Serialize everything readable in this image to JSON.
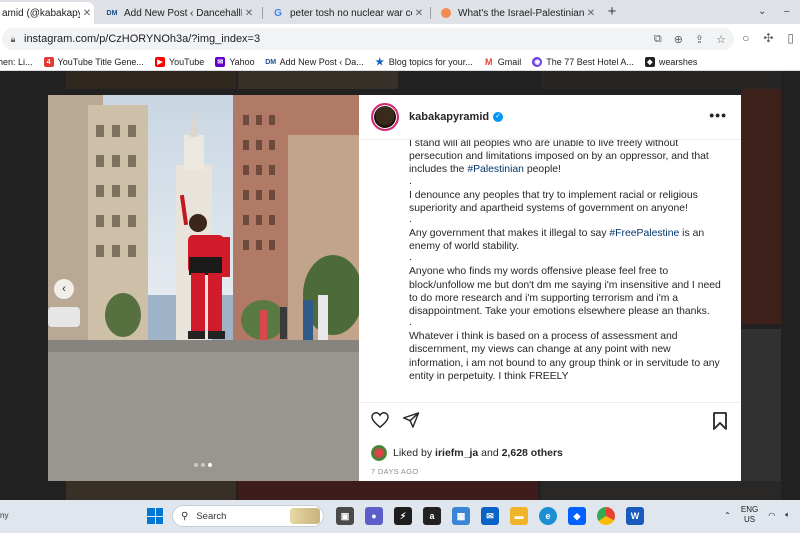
{
  "browser": {
    "tabs": [
      {
        "title": "amid (@kabakapyram",
        "favicon": "instagram-icon",
        "active": true
      },
      {
        "title": "Add New Post ‹ DancehallMag —",
        "favicon": "dm-icon",
        "active": false
      },
      {
        "title": "peter tosh no nuclear war conc",
        "favicon": "google-icon",
        "active": false
      },
      {
        "title": "What's the Israel-Palestinian con",
        "favicon": "orange-icon",
        "active": false
      }
    ],
    "new_tab": "+",
    "url": "instagram.com/p/CzHORYNOh3a/?img_index=3",
    "bookmarks": [
      {
        "label": "hen: Li...",
        "icon": "text"
      },
      {
        "label": "YouTube Title Gene...",
        "icon": "number-4-icon",
        "color": "#e53935"
      },
      {
        "label": "YouTube",
        "icon": "youtube-icon",
        "color": "#ff0000"
      },
      {
        "label": "Yahoo",
        "icon": "yahoo-icon",
        "color": "#6001d2"
      },
      {
        "label": "Add New Post ‹ Da...",
        "icon": "dm-icon",
        "color": "#1a4d8f"
      },
      {
        "label": "Blog topics for your...",
        "icon": "star-icon",
        "color": "#1565c0"
      },
      {
        "label": "Gmail",
        "icon": "gmail-icon",
        "color": "#ea4335"
      },
      {
        "label": "The 77 Best Hotel A...",
        "icon": "globe-icon",
        "color": "#6a3de8"
      },
      {
        "label": "wearshes",
        "icon": "dark-icon",
        "color": "#222222"
      }
    ]
  },
  "post": {
    "username": "kabakapyramid",
    "more": "•••",
    "caption": {
      "line1": "I stand will all peoples who are unable to live freely without persecution and limitations imposed on by an oppressor, and that includes the ",
      "tag1": "#Palestinian",
      "line1_end": " people!",
      "line2": "I denounce any peoples that try to implement racial or religious superiority and apartheid systems of government on anyone!",
      "line3": "Any government that makes it illegal to say ",
      "tag2": "#FreePalestine",
      "line3_end": " is an enemy of world stability.",
      "line4": "Anyone who finds my words offensive please feel free to block/unfollow me but don't dm me saying i'm insensitive and I need to do more research and i'm supporting terrorism and i'm a disappointment. Take your emotions elsewhere please an thanks.",
      "line5": "Whatever i think is based on a process of assessment and discernment, my views can change at any point with new information, i am not bound to any group think or in servitude to any entity in perpetuity. I think FREELY",
      "dot": "."
    },
    "liked_prefix": "Liked by ",
    "liked_user": "iriefm_ja",
    "liked_mid": " and ",
    "liked_count": "2,628 others",
    "time_ago": "7 DAYS AGO",
    "carousel_index": 3,
    "carousel_total": 3
  },
  "taskbar": {
    "left_text": "ny",
    "search_placeholder": "Search",
    "lang_top": "ENG",
    "lang_bottom": "US"
  }
}
